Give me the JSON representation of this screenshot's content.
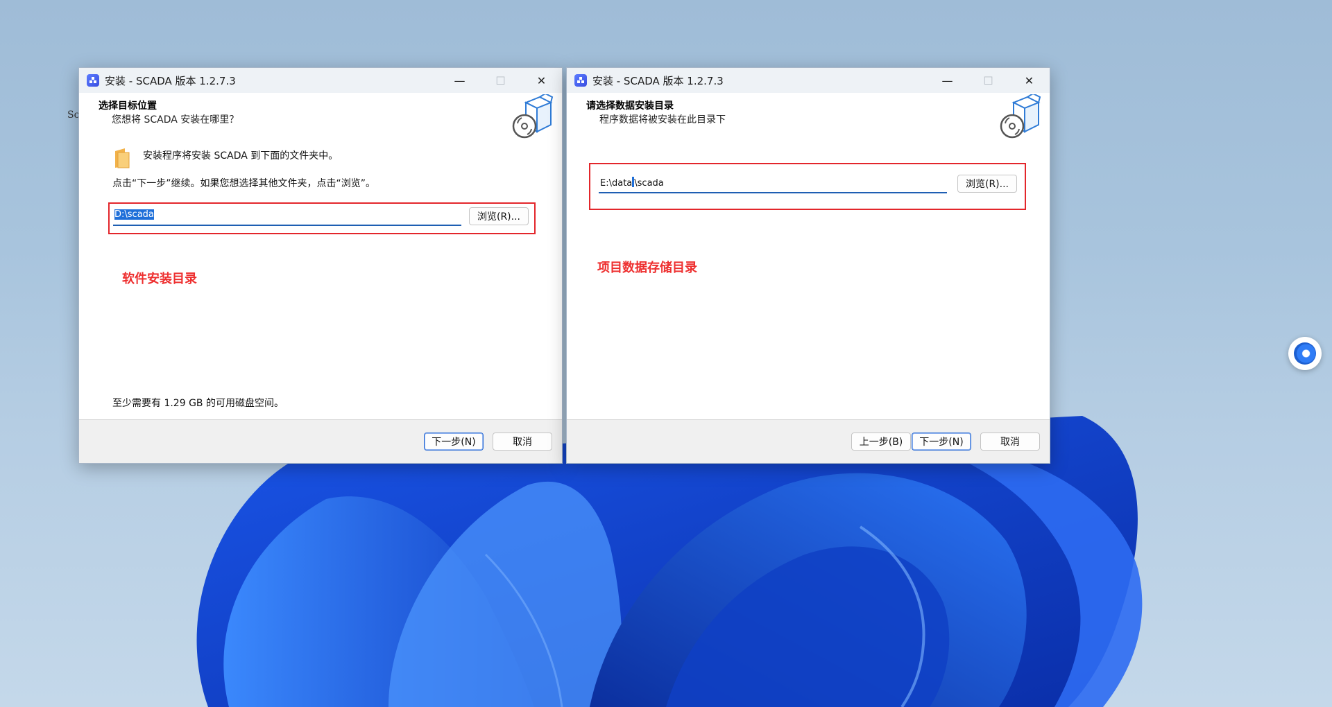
{
  "desktop": {
    "peek_text": "Sc",
    "colors": {
      "accent_red": "#e3262b",
      "selection_blue": "#1e6fd9"
    }
  },
  "left_window": {
    "title": "安装 - SCADA 版本 1.2.7.3",
    "controls": {
      "minimize": "—",
      "maximize": "☐",
      "close": "✕"
    },
    "header_title": "选择目标位置",
    "header_subtitle": "您想将 SCADA 安装在哪里？",
    "message": "安装程序将安装 SCADA 到下面的文件夹中。",
    "instruction": "点击“下一步”继续。如果您想选择其他文件夹，点击“浏览”。",
    "path_value": "D:\\scada",
    "browse_label": "浏览(R)...",
    "annotation": "软件安装目录",
    "space_note": "至少需要有 1.29 GB 的可用磁盘空间。",
    "next_label": "下一步(N)",
    "cancel_label": "取消"
  },
  "right_window": {
    "title": "安装 - SCADA 版本 1.2.7.3",
    "controls": {
      "minimize": "—",
      "maximize": "☐",
      "close": "✕"
    },
    "header_title": "请选择数据安装目录",
    "header_subtitle": "程序数据将被安装在此目录下",
    "path_before_caret": "E:\\data",
    "path_after_caret": "\\scada",
    "browse_label": "浏览(R)...",
    "annotation": "项目数据存储目录",
    "back_label": "上一步(B)",
    "next_label": "下一步(N)",
    "cancel_label": "取消"
  }
}
